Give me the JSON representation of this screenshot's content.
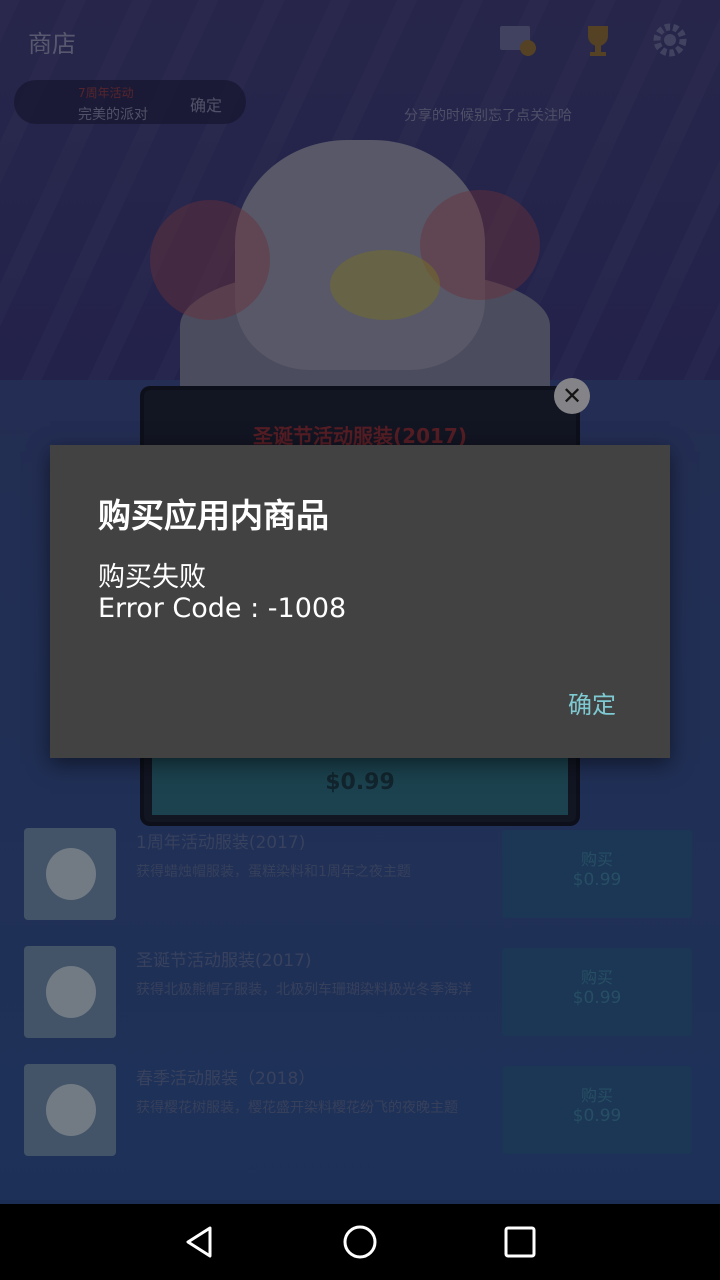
{
  "background": {
    "shop_title": "商店",
    "hint": {
      "tag": "7周年活动",
      "subtitle": "完美的派对",
      "confirm": "确定"
    },
    "share_hint": "分享的时候别忘了点关注哈",
    "featured_card": {
      "title": "圣诞节活动服装(2017)",
      "price": "$0.99"
    },
    "items": [
      {
        "name": "1周年活动服装(2017)",
        "desc": "获得蜡烛帽服装，蛋糕染料和1周年之夜主题",
        "buy_label": "购买",
        "price": "$0.99"
      },
      {
        "name": "圣诞节活动服装(2017)",
        "desc": "获得北极熊帽子服装，北极列车珊瑚染料极光冬季海洋",
        "buy_label": "购买",
        "price": "$0.99"
      },
      {
        "name": "春季活动服装（2018）",
        "desc": "获得樱花树服装，樱花盛开染料樱花纷飞的夜晚主题",
        "buy_label": "购买",
        "price": "$0.99"
      }
    ]
  },
  "dialog": {
    "title": "购买应用内商品",
    "message_line1": "购买失败",
    "message_line2": "Error Code : -1008",
    "ok_label": "确定"
  },
  "colors": {
    "dialog_bg": "#424242",
    "accent": "#7fcad2",
    "nav_bg": "#000000"
  }
}
